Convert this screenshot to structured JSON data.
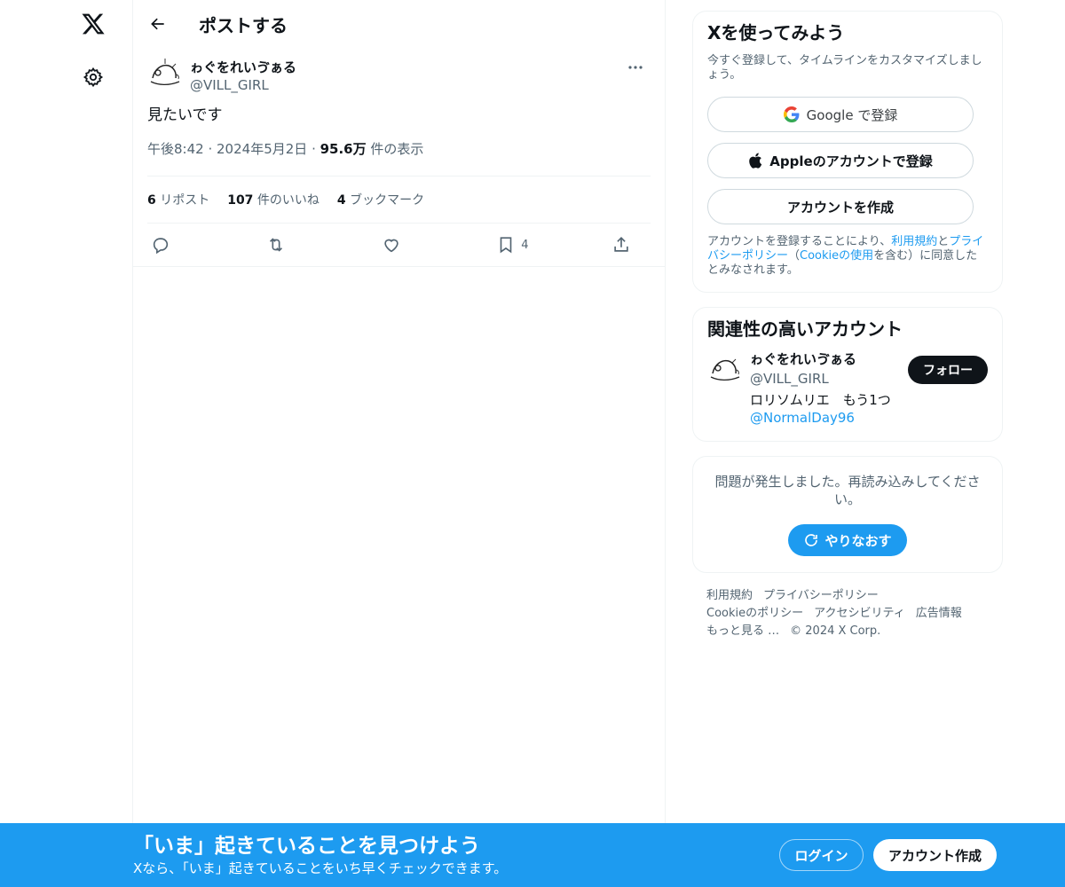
{
  "nav": {
    "logo_icon": "x-logo-icon",
    "settings_icon": "gear-icon"
  },
  "header": {
    "title": "ポストする"
  },
  "post": {
    "author_name": "ゎぐをれいゔぁる",
    "author_handle": "@VILL_GIRL",
    "text": "見たいです",
    "time": "午後8:42",
    "date": "2024年5月2日",
    "views_count": "95.6万",
    "views_label": "件の表示",
    "reposts_count": "6",
    "reposts_label": "リポスト",
    "likes_count": "107",
    "likes_label": "件のいいね",
    "bookmarks_count": "4",
    "bookmarks_label": "ブックマーク",
    "bookmark_action_count": "4"
  },
  "signup_card": {
    "title": "Xを使ってみよう",
    "subtitle": "今すぐ登録して、タイムラインをカスタマイズしましょう。",
    "google_label": "Google で登録",
    "apple_label": "Appleのアカウントで登録",
    "create_label": "アカウントを作成",
    "legal_prefix": "アカウントを登録することにより、",
    "terms_link": "利用規約",
    "legal_and": "と",
    "privacy_link": "プライバシーポリシー",
    "legal_open": "（",
    "cookie_link": "Cookieの使用",
    "legal_suffix": "を含む）に同意したとみなされます。"
  },
  "related": {
    "title": "関連性の高いアカウント",
    "name": "ゎぐをれいゔぁる",
    "handle": "@VILL_GIRL",
    "bio_text": "ロリソムリエ　もう1つ",
    "bio_link": "@NormalDay96",
    "follow_label": "フォロー"
  },
  "error_card": {
    "message": "問題が発生しました。再読み込みしてください。",
    "retry_label": "やりなおす"
  },
  "footer": {
    "links": [
      "利用規約",
      "プライバシーポリシー",
      "Cookieのポリシー",
      "アクセシビリティ",
      "広告情報",
      "もっと見る …"
    ],
    "copyright": "© 2024 X Corp."
  },
  "banner": {
    "title": "「いま」起きていることを見つけよう",
    "subtitle": "Xなら、「いま」起きていることをいち早くチェックできます。",
    "login_label": "ログイン",
    "signup_label": "アカウント作成"
  },
  "colors": {
    "accent": "#1d9bf0",
    "text": "#0f1419",
    "muted": "#536471"
  }
}
